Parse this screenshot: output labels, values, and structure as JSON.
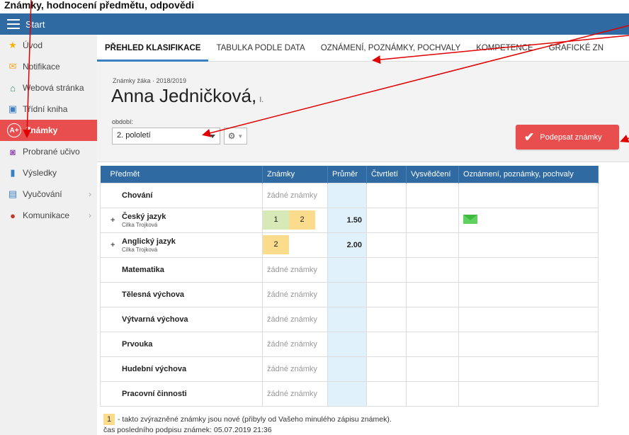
{
  "top_caption": "Známky, hodnocení předmětu, odpovědi",
  "topbar": {
    "title": "Start"
  },
  "sidebar": {
    "items": [
      {
        "name": "uvod",
        "label": "Úvod",
        "icon": "star-icon"
      },
      {
        "name": "notifikace",
        "label": "Notifikace",
        "icon": "envelope-icon"
      },
      {
        "name": "webova-stranka",
        "label": "Webová stránka",
        "icon": "home-icon"
      },
      {
        "name": "tridni-kniha",
        "label": "Třídní kniha",
        "icon": "book-icon"
      },
      {
        "name": "znamky",
        "label": "Známky",
        "icon": "grades-icon",
        "active": true
      },
      {
        "name": "probrane-ucivo",
        "label": "Probrané učivo",
        "icon": "teacher-icon"
      },
      {
        "name": "vysledky",
        "label": "Výsledky",
        "icon": "bar-chart-icon"
      },
      {
        "name": "vyucovani",
        "label": "Vyučování",
        "icon": "school-icon"
      },
      {
        "name": "komunikace",
        "label": "Komunikace",
        "icon": "chat-icon"
      }
    ]
  },
  "tabs": [
    {
      "label": "PŘEHLED KLASIFIKACE",
      "active": true
    },
    {
      "label": "TABULKA PODLE DATA"
    },
    {
      "label": "OZNÁMENÍ, POZNÁMKY, POCHVALY"
    },
    {
      "label": "KOMPETENCE"
    },
    {
      "label": "GRAFICKÉ ZN"
    }
  ],
  "header": {
    "subtitle": "Známky žáka · 2018/2019",
    "student_name": "Anna Jedničková,",
    "student_class": "I.",
    "period_label": "období:",
    "period_value": "2. pololetí",
    "sign_button": "Podepsat známky"
  },
  "table": {
    "columns": [
      "Předmět",
      "Známky",
      "Průměr",
      "Čtvrtletí",
      "Vysvědčení",
      "Oznámení, poznámky, pochvaly"
    ],
    "no_grades_text": "žádné známky",
    "rows": [
      {
        "subject": "Chování",
        "teacher": "",
        "expandable": false,
        "grades": [],
        "average": "",
        "note_icon": false
      },
      {
        "subject": "Český jazyk",
        "teacher": "Cilka Trojková",
        "expandable": true,
        "grades": [
          {
            "value": "1",
            "color": "#d7e9b6"
          },
          {
            "value": "2",
            "color": "#fbdc8d"
          }
        ],
        "average": "1.50",
        "note_icon": true
      },
      {
        "subject": "Anglický jazyk",
        "teacher": "Cilka Trojková",
        "expandable": true,
        "grades": [
          {
            "value": "2",
            "color": "#fbdc8d"
          }
        ],
        "average": "2.00",
        "note_icon": false
      },
      {
        "subject": "Matematika",
        "teacher": "",
        "expandable": false,
        "grades": [],
        "average": "",
        "note_icon": false
      },
      {
        "subject": "Tělesná výchova",
        "teacher": "",
        "expandable": false,
        "grades": [],
        "average": "",
        "note_icon": false
      },
      {
        "subject": "Výtvarná výchova",
        "teacher": "",
        "expandable": false,
        "grades": [],
        "average": "",
        "note_icon": false
      },
      {
        "subject": "Prvouka",
        "teacher": "",
        "expandable": false,
        "grades": [],
        "average": "",
        "note_icon": false
      },
      {
        "subject": "Hudební výchova",
        "teacher": "",
        "expandable": false,
        "grades": [],
        "average": "",
        "note_icon": false
      },
      {
        "subject": "Pracovní činnosti",
        "teacher": "",
        "expandable": false,
        "grades": [],
        "average": "",
        "note_icon": false
      }
    ]
  },
  "legend": {
    "mark": "1",
    "text": "- takto zvýrazněné známky jsou nové (přibyly od Vašeho minulého zápisu známek).",
    "last_signed": "čas posledního podpisu známek: 05.07.2019 21:36"
  },
  "colors": {
    "topbar": "#2f6aa2",
    "active": "#e84e4e",
    "annotation_arrow": "#e00000"
  }
}
